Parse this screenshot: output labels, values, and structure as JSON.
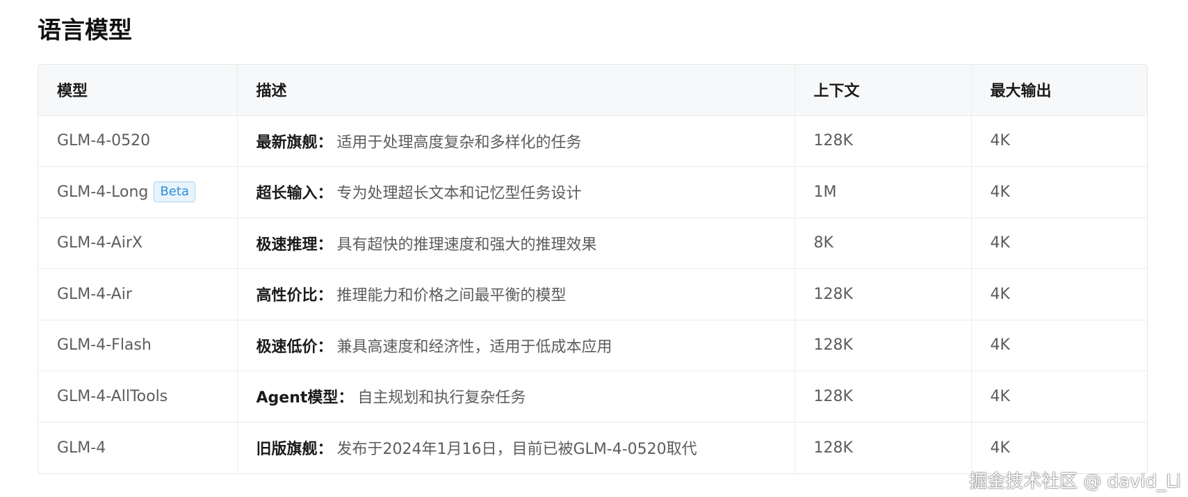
{
  "section_title": "语言模型",
  "table": {
    "headers": {
      "model": "模型",
      "description": "描述",
      "context": "上下文",
      "max_output": "最大输出"
    },
    "rows": [
      {
        "model": "GLM-4-0520",
        "badge": "",
        "desc_label": "最新旗舰",
        "desc_colon": "：",
        "desc_text": "适用于处理高度复杂和多样化的任务",
        "context": "128K",
        "max_output": "4K"
      },
      {
        "model": "GLM-4-Long",
        "badge": "Beta",
        "desc_label": "超长输入",
        "desc_colon": "：",
        "desc_text": "专为处理超长文本和记忆型任务设计",
        "context": "1M",
        "max_output": "4K"
      },
      {
        "model": "GLM-4-AirX",
        "badge": "",
        "desc_label": "极速推理",
        "desc_colon": "：",
        "desc_text": "具有超快的推理速度和强大的推理效果",
        "context": "8K",
        "max_output": "4K"
      },
      {
        "model": "GLM-4-Air",
        "badge": "",
        "desc_label": "高性价比",
        "desc_colon": "：",
        "desc_text": "推理能力和价格之间最平衡的模型",
        "context": "128K",
        "max_output": "4K"
      },
      {
        "model": "GLM-4-Flash",
        "badge": "",
        "desc_label": "极速低价",
        "desc_colon": "：",
        "desc_text": "兼具高速度和经济性，适用于低成本应用",
        "context": "128K",
        "max_output": "4K"
      },
      {
        "model": "GLM-4-AllTools",
        "badge": "",
        "desc_label": "Agent模型",
        "desc_colon": "：",
        "desc_text": "自主规划和执行复杂任务",
        "context": "128K",
        "max_output": "4K"
      },
      {
        "model": "GLM-4",
        "badge": "",
        "desc_label": "旧版旗舰",
        "desc_colon": "：",
        "desc_text": "发布于2024年1月16日，目前已被GLM-4-0520取代",
        "context": "128K",
        "max_output": "4K"
      }
    ]
  },
  "watermark": "掘金技术社区 @ david_Li"
}
